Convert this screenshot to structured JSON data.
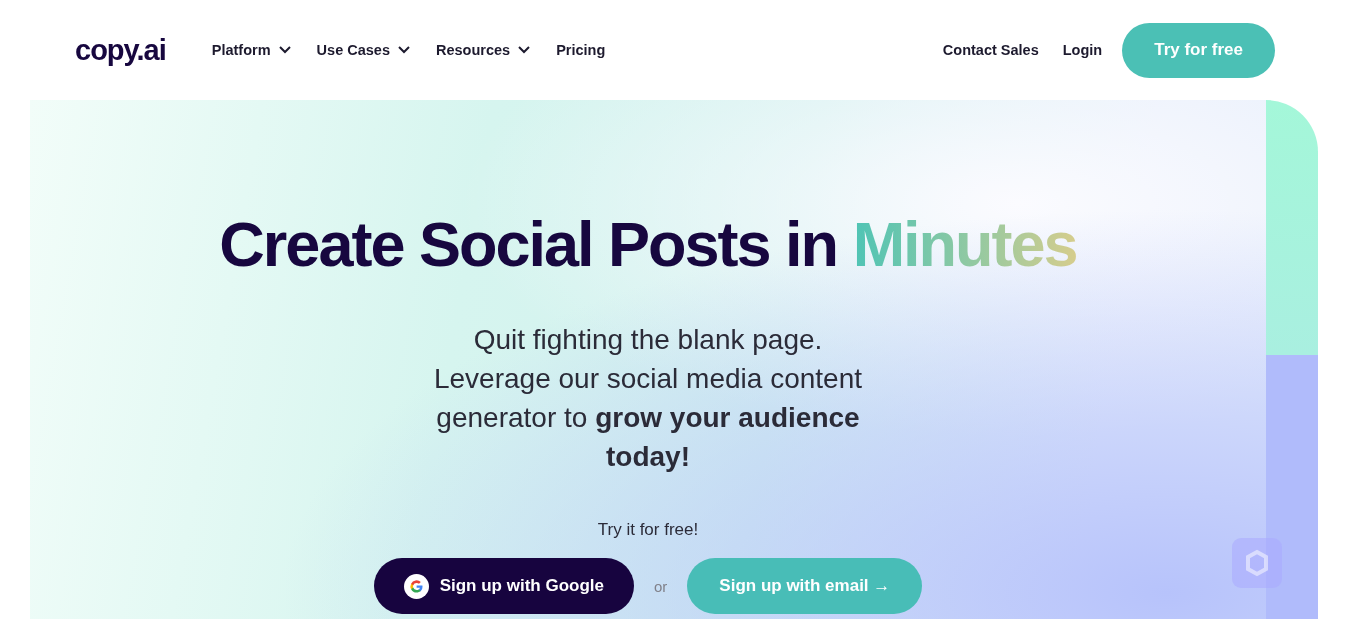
{
  "header": {
    "logo": "copy.ai",
    "nav": [
      {
        "label": "Platform",
        "dropdown": true
      },
      {
        "label": "Use Cases",
        "dropdown": true
      },
      {
        "label": "Resources",
        "dropdown": true
      },
      {
        "label": "Pricing",
        "dropdown": false
      }
    ],
    "actions": [
      "Contact Sales",
      "Login"
    ],
    "cta": "Try for free"
  },
  "hero": {
    "title": "Create Social Posts in",
    "title_highlight": "Minutes",
    "subtitle": "Quit fighting the blank page. Leverage our social media content generator to **grow your audience today!**",
    "try_label": "Try it for free!",
    "google_button": "Sign up with Google",
    "separator": "or",
    "email_button": "Sign up with email →"
  }
}
